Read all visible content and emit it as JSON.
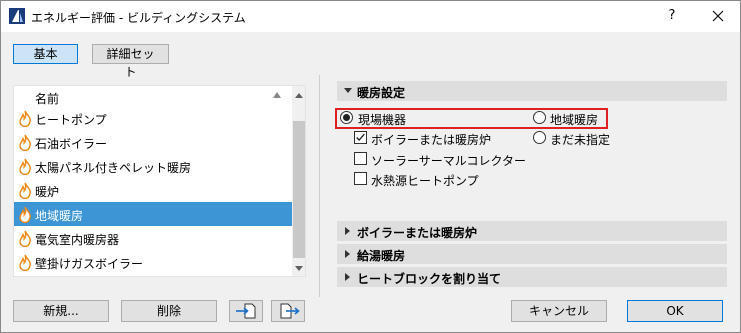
{
  "window": {
    "title": "エネルギー評価 - ビルディングシステム",
    "help_label": "?"
  },
  "tabs": [
    {
      "label": "基本",
      "selected": true
    },
    {
      "label": "詳細セット",
      "selected": false
    }
  ],
  "list": {
    "header": "名前",
    "items": [
      {
        "label": "ヒートポンプ",
        "icon": "flame-icon"
      },
      {
        "label": "石油ボイラー",
        "icon": "flame-icon"
      },
      {
        "label": "太陽パネル付きペレット暖房",
        "icon": "flame-icon"
      },
      {
        "label": "暖炉",
        "icon": "flame-icon"
      },
      {
        "label": "地域暖房",
        "icon": "flame-icon",
        "selected": true
      },
      {
        "label": "電気室内暖房器",
        "icon": "flame-icon"
      },
      {
        "label": "壁掛けガスボイラー",
        "icon": "flame-icon"
      }
    ]
  },
  "buttons": {
    "new": "新規...",
    "delete": "削除",
    "cancel": "キャンセル",
    "ok": "OK"
  },
  "sections": {
    "heating": "暖房設定",
    "boiler": "ボイラーまたは暖房炉",
    "hot_water": "給湯暖房",
    "heat_block": "ヒートブロックを割り当て"
  },
  "options": {
    "onsite": "現場機器",
    "district": "地域暖房",
    "boiler": "ボイラーまたは暖房炉",
    "unspecified": "まだ未指定",
    "solar_collector": "ソーラーサーマルコレクター",
    "water_heat_pump": "水熱源ヒートポンプ"
  },
  "colors": {
    "selection": "#3d95d6",
    "highlight_box": "#e02020",
    "flame": "#f08a1c"
  }
}
